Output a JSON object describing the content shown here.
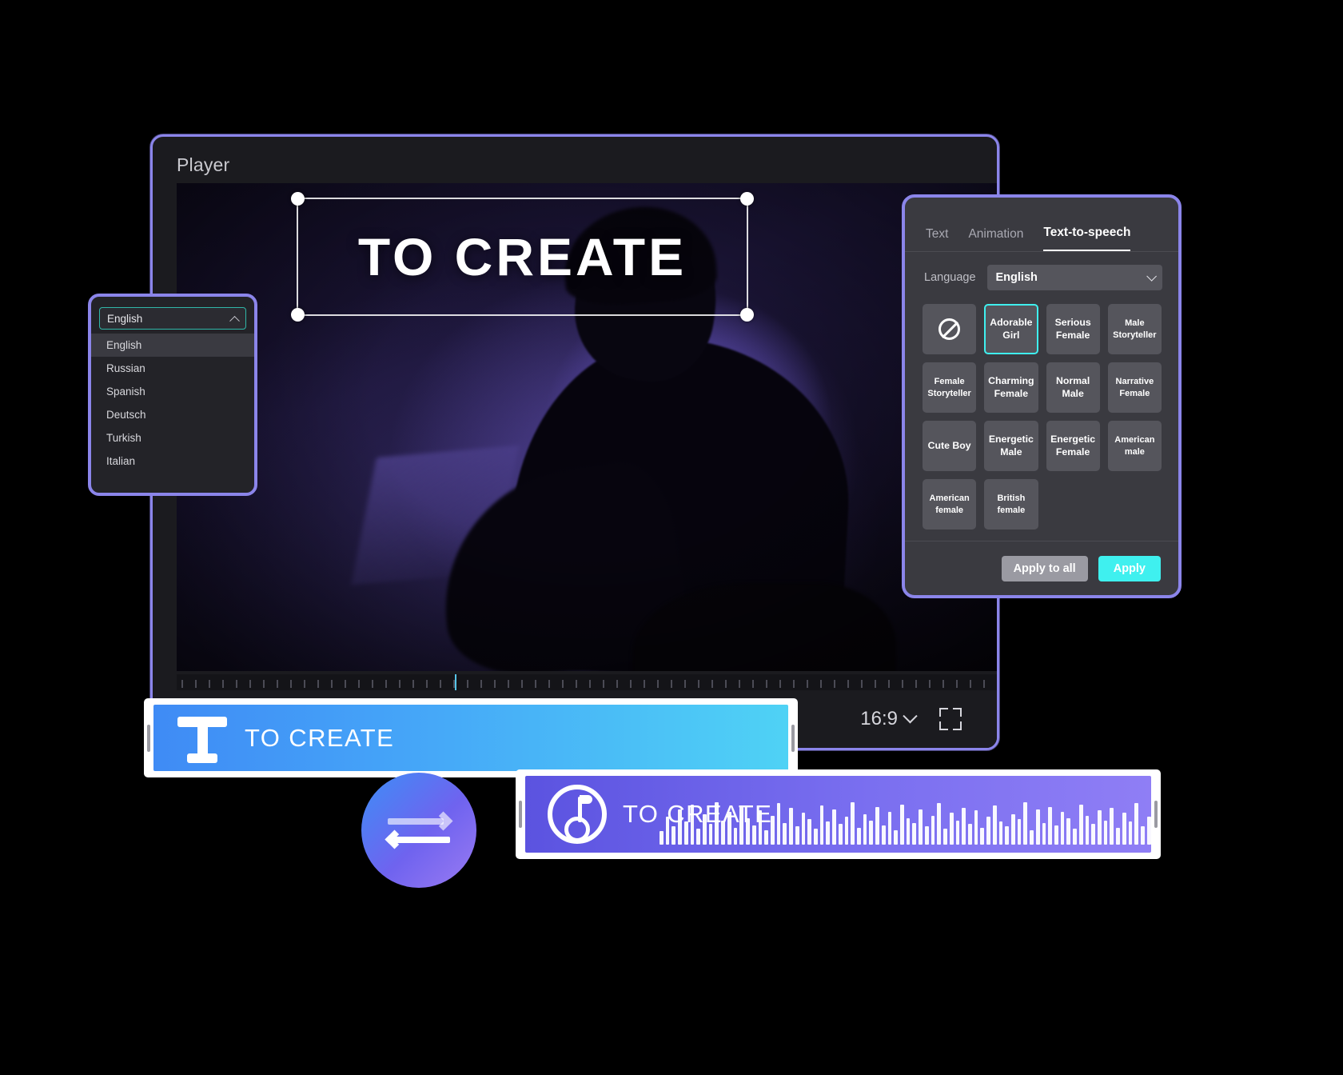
{
  "player": {
    "title": "Player",
    "overlay_text": "TO CREATE",
    "aspect_ratio": "16:9",
    "ratio_icon": "chevron-down-icon",
    "fullscreen_icon": "fullscreen-icon"
  },
  "language_dropdown": {
    "selected": "English",
    "caret_icon": "chevron-up-icon",
    "options": [
      "English",
      "Russian",
      "Spanish",
      "Deutsch",
      "Turkish",
      "Italian"
    ]
  },
  "tts_panel": {
    "tabs": [
      {
        "label": "Text",
        "active": false
      },
      {
        "label": "Animation",
        "active": false
      },
      {
        "label": "Text-to-speech",
        "active": true
      }
    ],
    "language_label": "Language",
    "language_value": "English",
    "language_caret_icon": "chevron-down-icon",
    "voices": [
      {
        "label": "",
        "icon": "no-voice-icon",
        "selected": false
      },
      {
        "label": "Adorable Girl",
        "selected": true
      },
      {
        "label": "Serious Female",
        "selected": false
      },
      {
        "label": "Male Storyteller",
        "selected": false,
        "small": true
      },
      {
        "label": "Female Storyteller",
        "selected": false,
        "small": true
      },
      {
        "label": "Charming Female",
        "selected": false
      },
      {
        "label": "Normal Male",
        "selected": false
      },
      {
        "label": "Narrative Female",
        "selected": false,
        "small": true
      },
      {
        "label": "Cute Boy",
        "selected": false
      },
      {
        "label": "Energetic Male",
        "selected": false
      },
      {
        "label": "Energetic Female",
        "selected": false
      },
      {
        "label": "American male",
        "selected": false,
        "small": true
      },
      {
        "label": "American female",
        "selected": false,
        "small": true
      },
      {
        "label": "British female",
        "selected": false,
        "small": true
      }
    ],
    "apply_to_all_label": "Apply to all",
    "apply_label": "Apply"
  },
  "timeline": {
    "text_clip": {
      "label": "TO CREATE",
      "icon": "text-tool-icon"
    },
    "audio_clip": {
      "label": "TO CREATE",
      "icon": "music-note-icon"
    },
    "swap_badge": {
      "icon": "swap-arrows-icon"
    }
  },
  "colors": {
    "accent_purple": "#8b85ea",
    "accent_cyan": "#3ff0ef",
    "select_teal": "#30b7a8",
    "text_clip_start": "#3f8bf5",
    "text_clip_end": "#4fd2f5",
    "audio_clip_start": "#5b53e0",
    "audio_clip_end": "#8f7ef5",
    "panel_bg": "#3a3a40",
    "cell_bg": "#55555c"
  }
}
